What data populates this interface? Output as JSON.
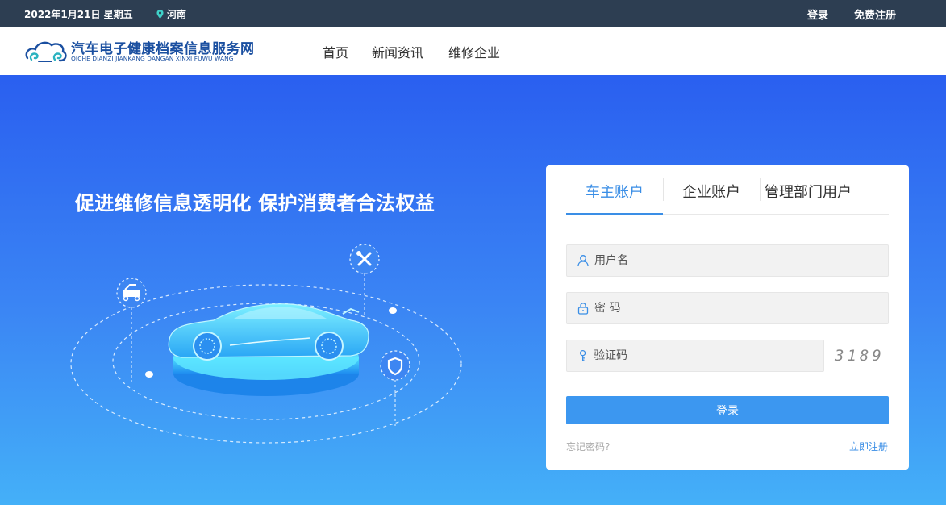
{
  "topbar": {
    "date": "2022年1月21日 星期五",
    "location": "河南",
    "login": "登录",
    "register": "免费注册"
  },
  "logo": {
    "title": "汽车电子健康档案信息服务网",
    "subtitle": "QICHE DIANZI JIANKANG DANGAN XINXI FUWU WANG"
  },
  "nav": {
    "items": [
      "首页",
      "新闻资讯",
      "维修企业"
    ]
  },
  "hero": {
    "slogan": "促进维修信息透明化 保护消费者合法权益"
  },
  "login": {
    "tabs": [
      "车主账户",
      "企业账户",
      "管理部门用户"
    ],
    "active_tab": "车主账户",
    "username_placeholder": "用户名",
    "password_placeholder": "密 码",
    "code_placeholder": "验证码",
    "captcha": "3189",
    "submit": "登录",
    "forgot": "忘记密码?",
    "register": "立即注册"
  },
  "colors": {
    "topbar_bg": "#2d3e52",
    "accent": "#3a8ee6",
    "button": "#3c97f0",
    "logo_blue": "#1a4fa0"
  },
  "icons": [
    "location-pin-icon",
    "user-icon",
    "lock-icon",
    "key-icon",
    "wrench-icon",
    "tow-truck-icon",
    "shield-icon"
  ]
}
